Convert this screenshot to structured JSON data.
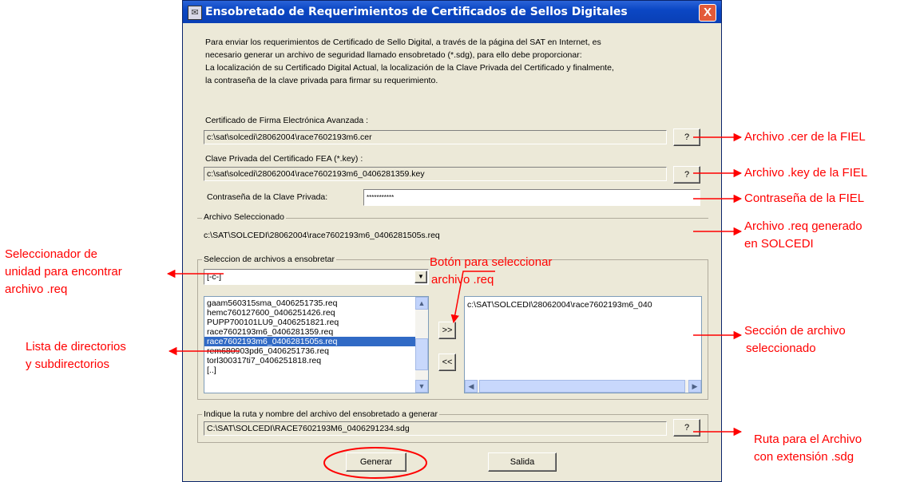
{
  "window": {
    "title": "Ensobretado de Requerimientos de Certificados de Sellos Digitales",
    "close_label": "X"
  },
  "intro": {
    "line1": "Para enviar  los requerimientos  de Certificado de Sello  Digital, a través de la página del SAT en  Internet, es",
    "line2": "necesario generar un archivo de seguridad llamado ensobretado (*.sdg),  para ello debe proporcionar:",
    "line3": "La localización de su Certificado Digital Actual, la localización de la Clave Privada  del Certificado y finalmente,",
    "line4": "la contraseña de la clave privada para firmar su requerimiento."
  },
  "cert": {
    "label": "Certificado de Firma Electrónica Avanzada :",
    "value": "c:\\sat\\solcedi\\28062004\\race7602193m6.cer",
    "browse_label": "?"
  },
  "key": {
    "label": "Clave Privada del Certificado FEA (*.key) :",
    "value": "c:\\sat\\solcedi\\28062004\\race7602193m6_0406281359.key",
    "browse_label": "?"
  },
  "password": {
    "label": "Contraseña de la Clave Privada:",
    "value": "***********"
  },
  "selected": {
    "title": "Archivo Seleccionado",
    "value": "c:\\SAT\\SOLCEDI\\28062004\\race7602193m6_0406281505s.req"
  },
  "selection": {
    "title": "Seleccion de archivos a ensobretar",
    "drive_value": "[-c-]",
    "files": [
      "gaam560315sma_0406251735.req",
      "hemc760127600_0406251426.req",
      "PUPP700101LU9_0406251821.req",
      "race7602193m6_0406281359.req",
      "race7602193m6_0406281505s.req",
      "rem680903pd6_0406251736.req",
      "torl300317ti7_0406251818.req",
      "[..]"
    ],
    "selected_index": 4,
    "add_label": ">>",
    "remove_label": "<<",
    "chosen": [
      "c:\\SAT\\SOLCEDI\\28062004\\race7602193m6_040"
    ]
  },
  "output": {
    "title": "Indique la ruta y nombre del archivo del ensobretado a generar",
    "value": "C:\\SAT\\SOLCEDI\\RACE7602193M6_0406291234.sdg",
    "browse_label": "?"
  },
  "actions": {
    "generate_label": "Generar",
    "exit_label": "Salida"
  },
  "annotations": {
    "cer": "Archivo .cer de la FIEL",
    "key": "Archivo .key de la FIEL",
    "password": "Contraseña de la FIEL",
    "req_line1": "Archivo .req generado",
    "req_line2": "en SOLCEDI",
    "drive_line1": "Seleccionador de",
    "drive_line2": "unidad para encontrar",
    "drive_line3": "archivo .req",
    "button_line1": "Botón para seleccionar",
    "button_line2": "archivo .req",
    "dirs_line1": "Lista de directorios",
    "dirs_line2": "y subdirectorios",
    "section_line1": "Sección de archivo",
    "section_line2": "seleccionado",
    "route_line1": "Ruta para el Archivo",
    "route_line2": "con extensión .sdg",
    "accent_color": "#ff0000"
  }
}
